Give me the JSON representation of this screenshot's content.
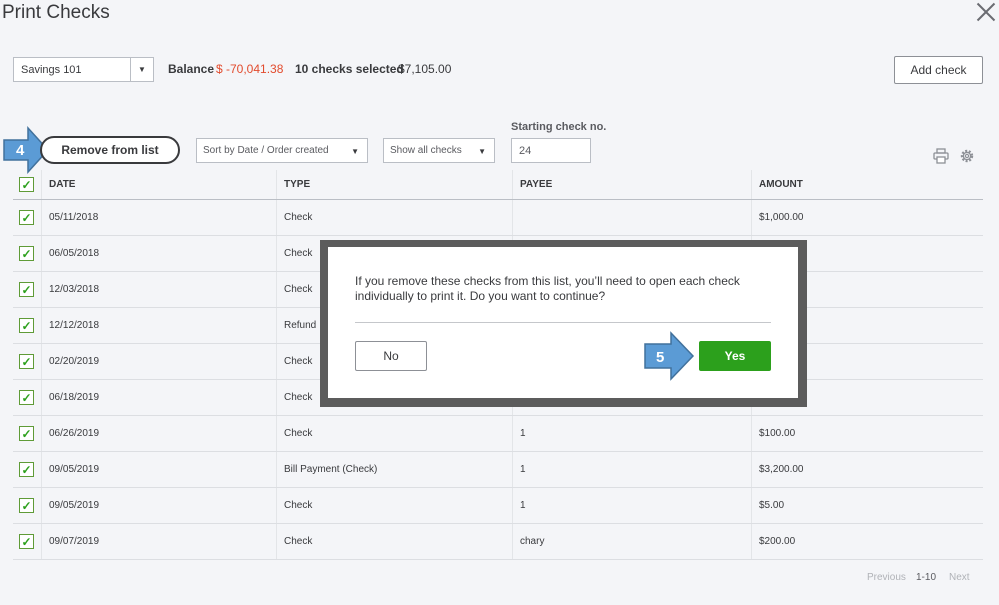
{
  "header": {
    "title": "Print Checks"
  },
  "toolbar": {
    "account": "Savings 101",
    "balance_label": "Balance",
    "balance_value": "$ -70,041.38",
    "selected_label": "10 checks selected",
    "selected_total": "$7,105.00",
    "add_check_label": "Add check",
    "remove_label": "Remove from list",
    "sort_value": "Sort by Date / Order created",
    "filter_value": "Show all checks",
    "starting_check_label": "Starting check no.",
    "starting_check_value": "24"
  },
  "callouts": {
    "step4": "4",
    "step5": "5"
  },
  "table": {
    "columns": [
      "DATE",
      "TYPE",
      "PAYEE",
      "AMOUNT"
    ],
    "rows": [
      {
        "date": "05/11/2018",
        "type": "Check",
        "payee": "",
        "amount": "$1,000.00"
      },
      {
        "date": "06/05/2018",
        "type": "Check",
        "payee": "",
        "amount": ""
      },
      {
        "date": "12/03/2018",
        "type": "Check",
        "payee": "",
        "amount": ""
      },
      {
        "date": "12/12/2018",
        "type": "Refund",
        "payee": "",
        "amount": ""
      },
      {
        "date": "02/20/2019",
        "type": "Check",
        "payee": "",
        "amount": ""
      },
      {
        "date": "06/18/2019",
        "type": "Check",
        "payee": "",
        "amount": ""
      },
      {
        "date": "06/26/2019",
        "type": "Check",
        "payee": "1",
        "amount": "$100.00"
      },
      {
        "date": "09/05/2019",
        "type": "Bill Payment (Check)",
        "payee": "1",
        "amount": "$3,200.00"
      },
      {
        "date": "09/05/2019",
        "type": "Check",
        "payee": "1",
        "amount": "$5.00"
      },
      {
        "date": "09/07/2019",
        "type": "Check",
        "payee": "chary",
        "amount": "$200.00"
      }
    ]
  },
  "pagination": {
    "previous": "Previous",
    "range": "1-10",
    "next": "Next"
  },
  "dialog": {
    "message": "If you remove these checks from this list, you’ll need to open each check individually to print it. Do you want to continue?",
    "no_label": "No",
    "yes_label": "Yes"
  },
  "colors": {
    "accent_green": "#2ca01c",
    "negative": "#e24b2d",
    "callout_blue": "#5b9bd5"
  },
  "icons": [
    "close-icon",
    "chevron-down-icon",
    "printer-icon",
    "gear-icon",
    "checkmark-icon",
    "arrow-callout-icon"
  ]
}
